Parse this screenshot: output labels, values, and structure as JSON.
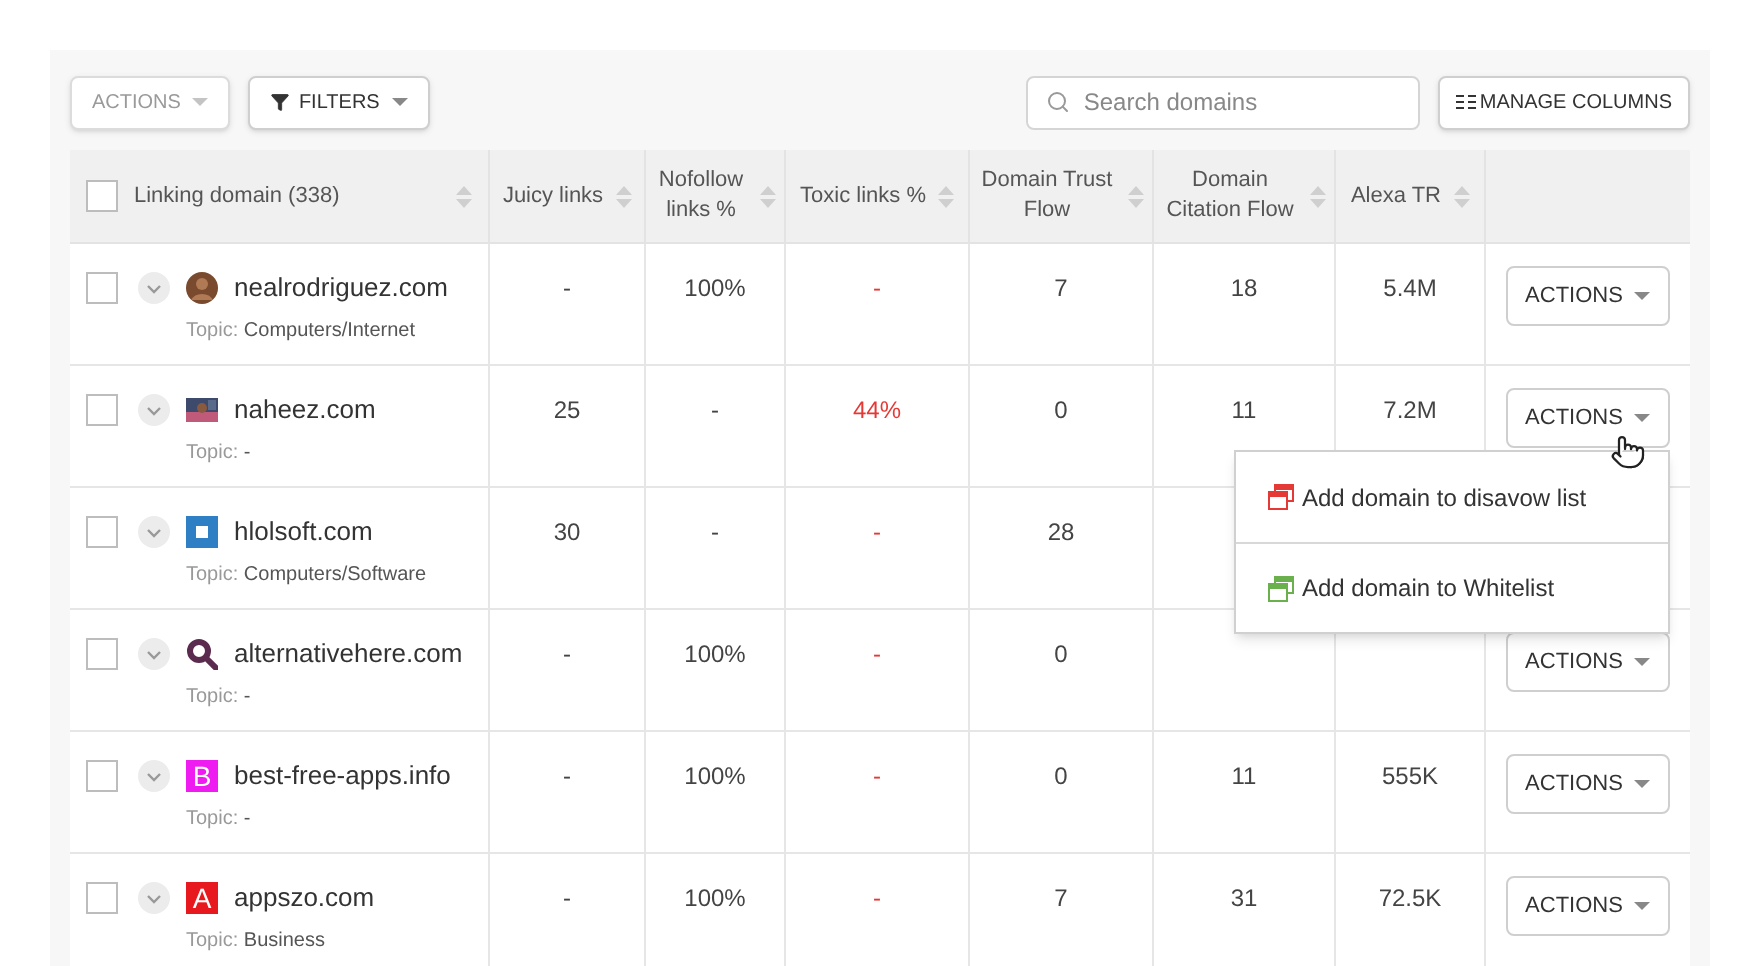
{
  "toolbar": {
    "actions_button": {
      "label": "ACTIONS",
      "disabled": true
    },
    "filters_button": {
      "label": "FILTERS"
    },
    "search": {
      "placeholder": "Search domains"
    },
    "manage_columns_button": {
      "label": "MANAGE COLUMNS"
    }
  },
  "table": {
    "select_all_checked": false,
    "columns": [
      "Linking domain (338)",
      "Juicy links",
      "Nofollow links %",
      "Toxic links %",
      "Domain Trust Flow",
      "Domain Citation Flow",
      "Alexa TR"
    ],
    "rows": [
      {
        "checked": false,
        "favicon": {
          "kind": "avatar"
        },
        "domain": "nealrodriguez.com",
        "topic_label": "Topic:",
        "topic": "Computers/Internet",
        "juicy": "-",
        "nofollow": "100%",
        "toxic": "-",
        "trust": "7",
        "citation": "18",
        "alexa": "5.4M",
        "action": "ACTIONS"
      },
      {
        "checked": false,
        "domain": "naheez.com",
        "topic_label": "Topic:",
        "topic": "-",
        "juicy": "25",
        "nofollow": "-",
        "toxic": "44%",
        "trust": "0",
        "citation": "11",
        "alexa": "7.2M",
        "action": "ACTIONS"
      },
      {
        "checked": false,
        "favicon": {
          "kind": "square"
        },
        "domain": "hlolsoft.com",
        "topic_label": "Topic:",
        "topic": "Computers/Software",
        "juicy": "30",
        "nofollow": "-",
        "toxic": "-",
        "trust": "28"
      },
      {
        "checked": false,
        "favicon": {
          "kind": "search"
        },
        "domain": "alternativehere.com",
        "topic_label": "Topic:",
        "topic": "-",
        "juicy": "-",
        "nofollow": "100%",
        "toxic": "-",
        "trust": "0",
        "action": "ACTIONS"
      },
      {
        "checked": false,
        "favicon": {
          "kind": "letter",
          "letter": "B",
          "color": "#ee1cf0"
        },
        "domain": "best-free-apps.info",
        "topic_label": "Topic:",
        "topic": "-",
        "juicy": "-",
        "nofollow": "100%",
        "toxic": "-",
        "trust": "0",
        "citation": "11",
        "alexa": "555K",
        "action": "ACTIONS"
      },
      {
        "checked": false,
        "favicon": {
          "kind": "letter",
          "letter": "A",
          "color": "#e8191e"
        },
        "domain": "appszo.com",
        "topic_label": "Topic:",
        "topic": "Business",
        "juicy": "-",
        "nofollow": "100%",
        "toxic": "-",
        "trust": "7",
        "citation": "31",
        "alexa": "72.5K",
        "action": "ACTIONS"
      }
    ]
  },
  "actions_menu": {
    "items": [
      {
        "label": "Add domain to disavow list",
        "color": "#e53935"
      },
      {
        "label": "Add domain to Whitelist",
        "color": "#6ab04c"
      }
    ]
  }
}
